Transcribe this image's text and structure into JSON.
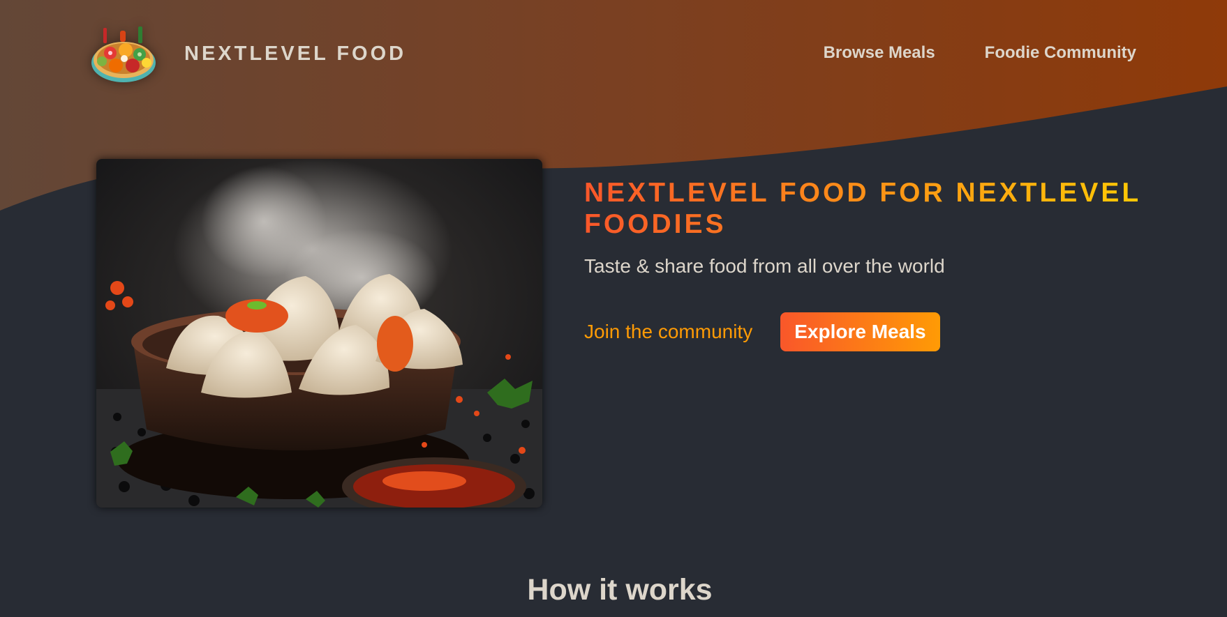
{
  "header": {
    "logo_text": "NEXTLEVEL FOOD",
    "nav": [
      {
        "label": "Browse Meals"
      },
      {
        "label": "Foodie Community"
      }
    ]
  },
  "hero": {
    "title": "NEXTLEVEL FOOD FOR NEXTLEVEL FOODIES",
    "subtitle": "Taste & share food from all over the world",
    "community_link": "Join the community",
    "explore_button": "Explore Meals"
  },
  "main": {
    "section_heading": "How it works"
  },
  "colors": {
    "background": "#282c34",
    "header_gradient_start": "#6a4634",
    "header_gradient_end": "#8f3a09",
    "accent_start": "#f9572a",
    "accent_end": "#ffc905",
    "link": "#ff9b05",
    "text": "#ddd6cb"
  }
}
